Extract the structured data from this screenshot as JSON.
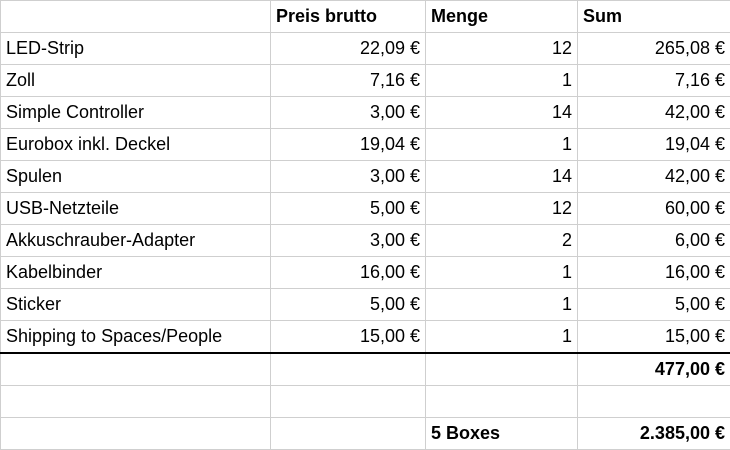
{
  "header": {
    "col1": "",
    "col2": "Preis brutto",
    "col3": "Menge",
    "col4": "Sum"
  },
  "items": [
    {
      "name": "LED-Strip",
      "price": "22,09 €",
      "qty": "12",
      "sum": "265,08 €"
    },
    {
      "name": "Zoll",
      "price": "7,16 €",
      "qty": "1",
      "sum": "7,16 €"
    },
    {
      "name": "Simple Controller",
      "price": "3,00 €",
      "qty": "14",
      "sum": "42,00 €"
    },
    {
      "name": "Eurobox inkl. Deckel",
      "price": "19,04 €",
      "qty": "1",
      "sum": "19,04 €"
    },
    {
      "name": "Spulen",
      "price": "3,00 €",
      "qty": "14",
      "sum": "42,00 €"
    },
    {
      "name": "USB-Netzteile",
      "price": "5,00 €",
      "qty": "12",
      "sum": "60,00 €"
    },
    {
      "name": "Akkuschrauber-Adapter",
      "price": "3,00 €",
      "qty": "2",
      "sum": "6,00 €"
    },
    {
      "name": "Kabelbinder",
      "price": "16,00 €",
      "qty": "1",
      "sum": "16,00 €"
    },
    {
      "name": "Sticker",
      "price": "5,00 €",
      "qty": "1",
      "sum": "5,00 €"
    },
    {
      "name": "Shipping to Spaces/People",
      "price": "15,00 €",
      "qty": "1",
      "sum": "15,00 €"
    }
  ],
  "totals": {
    "subtotal": "477,00 €",
    "boxes_label": "5 Boxes",
    "boxes_total": "2.385,00 €"
  }
}
